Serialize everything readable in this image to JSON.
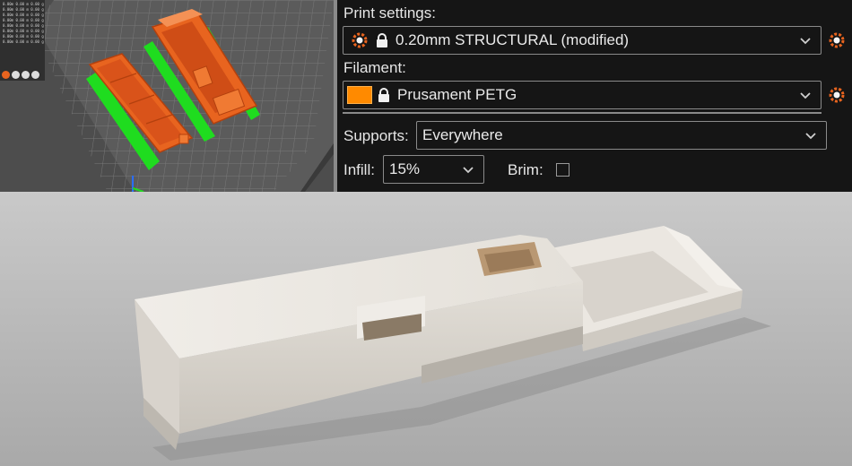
{
  "viewport": {
    "stats_rows": [
      "0.00m  0.00 m  0.00 g",
      "0.00m  0.00 m  0.00 g",
      "0.00m  0.00 m  0.00 g",
      "0.00m  0.00 m  0.00 g",
      "0.00m  0.00 m  0.00 g",
      "0.00m  0.00 m  0.00 g",
      "0.00m  0.00 m  0.00 g",
      "0.00m  0.00 m  0.00 g"
    ],
    "object_color": "#e8641f",
    "support_color": "#1fdc1f",
    "bed_color": "#5a5a5a"
  },
  "panel": {
    "print_settings_label": "Print settings:",
    "print_settings_value": "0.20mm STRUCTURAL (modified)",
    "filament_label": "Filament:",
    "filament_value": "Prusament PETG",
    "filament_color": "#ff8a00",
    "supports_label": "Supports:",
    "supports_value": "Everywhere",
    "infill_label": "Infill:",
    "infill_value": "15%",
    "brim_label": "Brim:",
    "brim_checked": false
  },
  "photo": {
    "subject": "printed-case-photo",
    "background_color": "#b8b8b8",
    "object_color": "#e8e4de"
  }
}
